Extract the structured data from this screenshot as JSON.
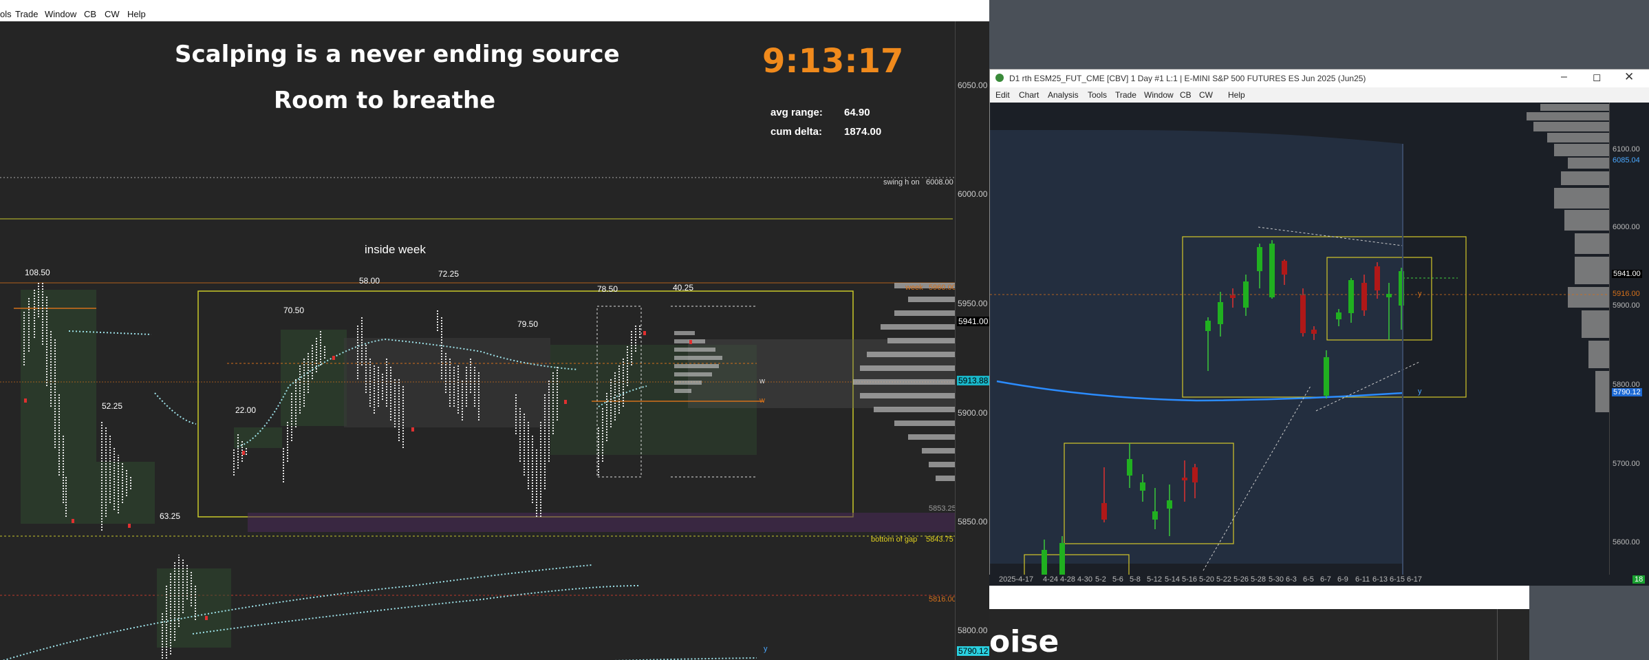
{
  "left": {
    "menu": [
      "ols",
      "Trade",
      "Window",
      "CB",
      "CW",
      "Help"
    ],
    "headline1": "Scalping is a never ending source",
    "headline2": "Room to breathe",
    "clock": "9:13:17",
    "stats": {
      "avg_range_label": "avg range:",
      "avg_range_value": "64.90",
      "cum_delta_label": "cum delta:",
      "cum_delta_value": "1874.00"
    },
    "inside_week": "inside week",
    "bar_labels": [
      "108.50",
      "52.25",
      "63.25",
      "22.00",
      "70.50",
      "58.00",
      "72.25",
      "79.50",
      "78.50",
      "40.25"
    ],
    "level_labels": {
      "swing_h": "swing h on",
      "swing_h_val": "6008.00",
      "week": "week",
      "week_val": "5960.00",
      "bottom_gap": "bottom of gap",
      "bottom_gap_val": "5843.75",
      "lvl_5816": "5816.00",
      "lvl_5853": "5853.25"
    },
    "axis": [
      "6050.00",
      "6000.00",
      "5950.00",
      "5941.00",
      "5913.88",
      "5900.00",
      "5850.00",
      "5800.00",
      "5790.12"
    ],
    "markers": [
      "w",
      "w",
      "y"
    ]
  },
  "right": {
    "title": "D1 rth ESM25_FUT_CME [CBV]  1 Day  #1 L:1 | E-MINI S&P 500 FUTURES ES Jun 2025 (Jun25)",
    "menu": [
      "Edit",
      "Chart",
      "Analysis",
      "Tools",
      "Trade",
      "Window",
      "CB",
      "CW",
      "Help"
    ],
    "axis": [
      "6100.00",
      "6085.04",
      "6000.00",
      "5941.00",
      "5916.00",
      "5900.00",
      "5800.00",
      "5790.12",
      "5700.00",
      "5600.00"
    ],
    "dates": [
      "2025-4-17",
      "4-24",
      "4-28",
      "4-30",
      "5-2",
      "5-6",
      "5-8",
      "5-12",
      "5-14",
      "5-16",
      "5-20",
      "5-22",
      "5-26",
      "5-28",
      "5-30",
      "6-3",
      "6-5",
      "6-7",
      "6-9",
      "6-11",
      "6-13",
      "6-15",
      "6-17"
    ],
    "badge": "18",
    "y_marker": "y",
    "bottom_text": "oise"
  }
}
